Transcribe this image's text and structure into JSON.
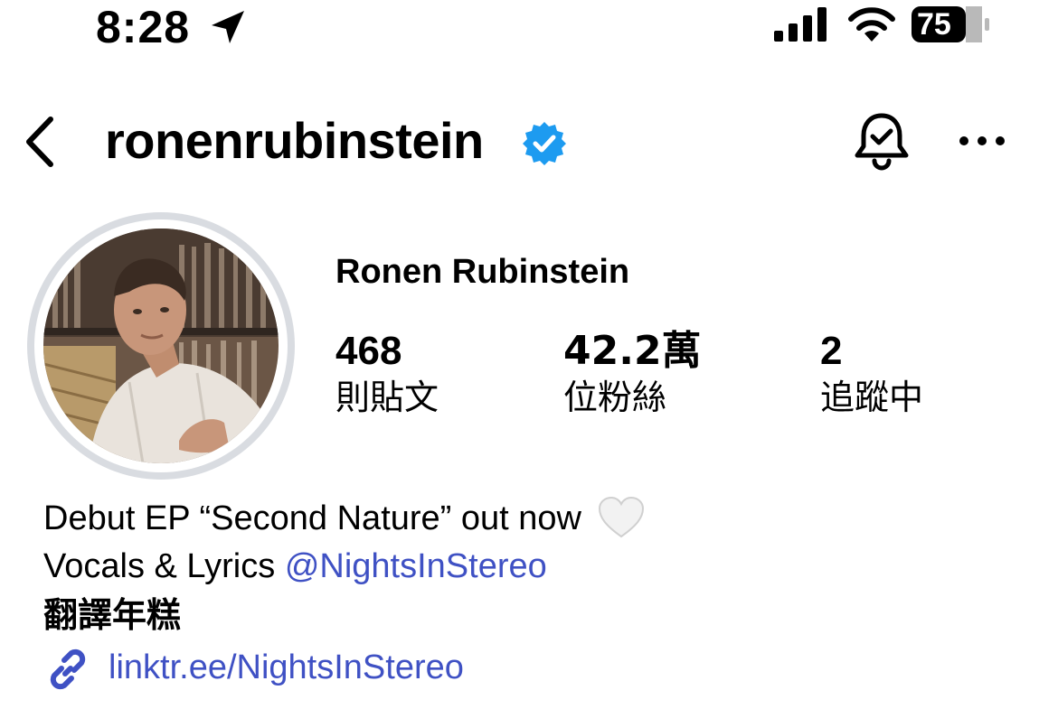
{
  "status_bar": {
    "time": "8:28",
    "battery": "75",
    "icons": [
      "location-arrow-icon",
      "cellular-signal-icon",
      "wifi-icon",
      "battery-icon"
    ]
  },
  "header": {
    "username": "ronenrubinstein",
    "icons": [
      "chevron-left-icon",
      "verified-badge-icon",
      "bell-check-icon",
      "ellipsis-icon"
    ]
  },
  "profile": {
    "display_name": "Ronen Rubinstein",
    "stats": [
      {
        "value": "468",
        "label": "則貼文"
      },
      {
        "value": "42.2萬",
        "label": "位粉絲"
      },
      {
        "value": "2",
        "label": "追蹤中"
      }
    ]
  },
  "bio": {
    "line1": "Debut EP “Second Nature” out now",
    "line1_emoji": "white-heart-icon",
    "line2_prefix": "Vocals & Lyrics ",
    "line2_mention": "@NightsInStereo",
    "translate": "翻譯年糕",
    "link_icon": "link-icon",
    "link": "linktr.ee/NightsInStereo"
  },
  "colors": {
    "accent_link": "#3f51c4",
    "verified_blue": "#1d9bf0",
    "avatar_ring": "#d9dce1"
  }
}
